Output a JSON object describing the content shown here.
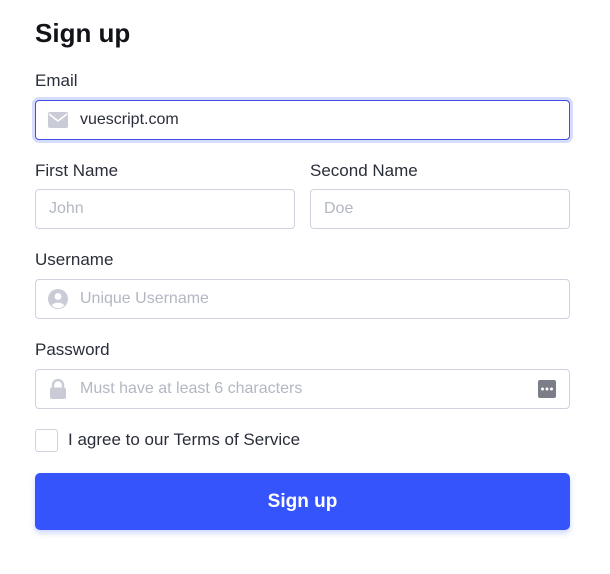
{
  "form": {
    "title": "Sign up",
    "email": {
      "label": "Email",
      "value": "vuescript.com",
      "icon": "envelope-icon"
    },
    "first_name": {
      "label": "First Name",
      "placeholder": "John"
    },
    "second_name": {
      "label": "Second Name",
      "placeholder": "Doe"
    },
    "username": {
      "label": "Username",
      "placeholder": "Unique Username",
      "icon": "user-circle-icon"
    },
    "password": {
      "label": "Password",
      "placeholder": "Must have at least 6 characters",
      "icon": "lock-icon",
      "trail_icon": "password-dots-icon"
    },
    "terms": {
      "label": "I agree to our Terms of Service",
      "checked": false
    },
    "submit_label": "Sign up"
  },
  "colors": {
    "accent": "#3554fb",
    "focus_border": "#3d4fe0",
    "input_border": "#cfd3df",
    "icon_gray": "#c9ccd6"
  }
}
